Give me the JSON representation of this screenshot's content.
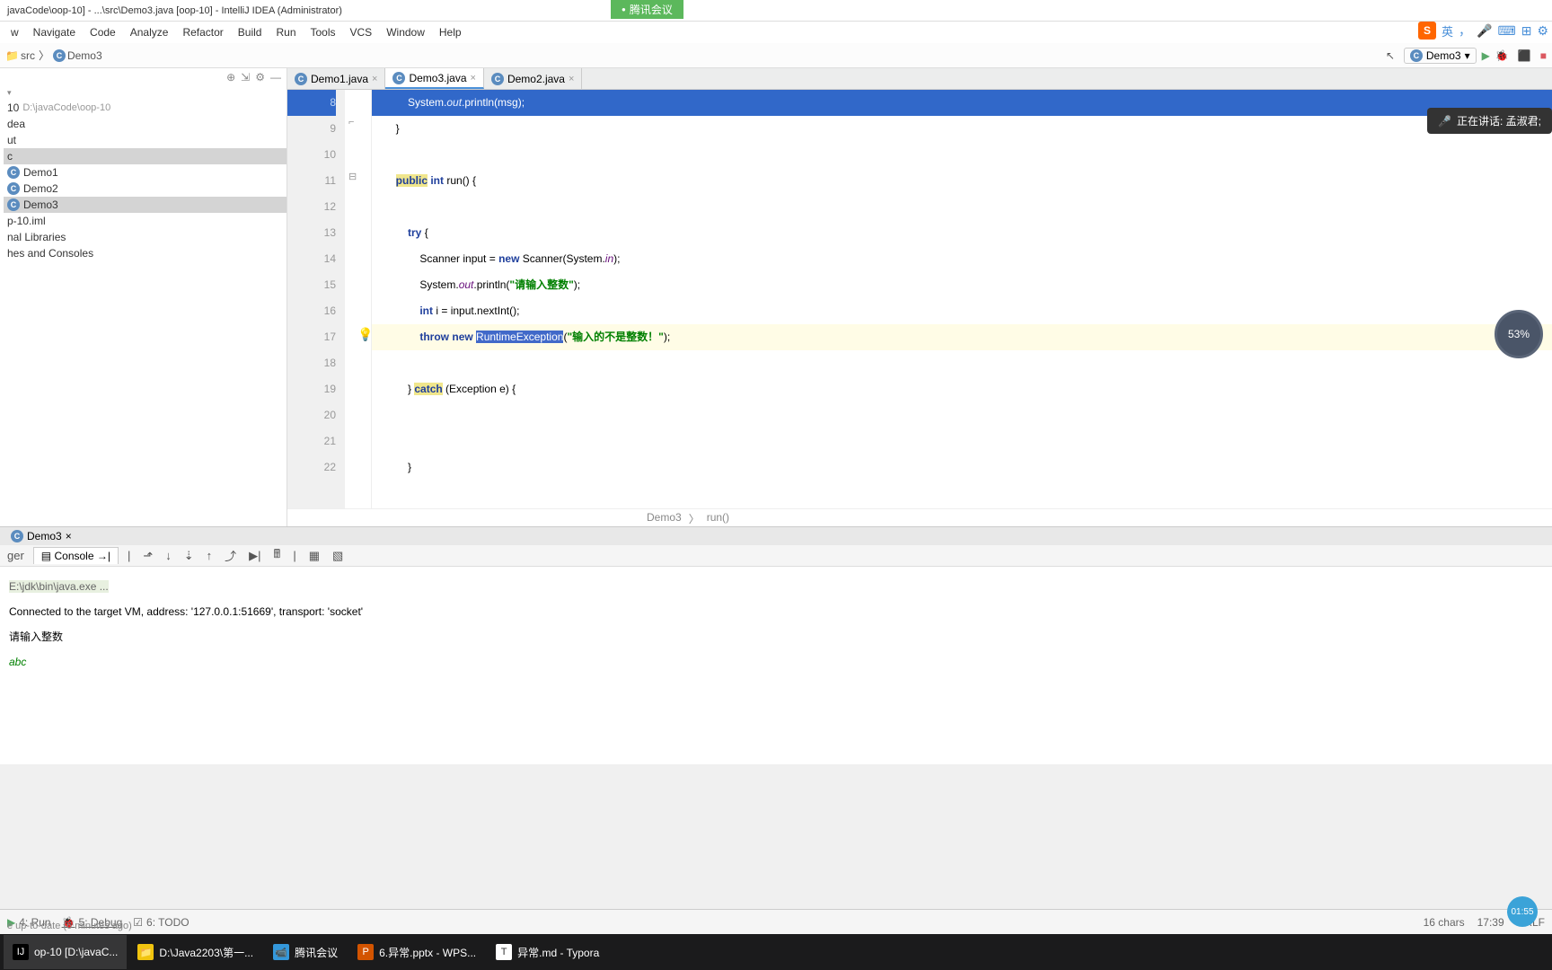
{
  "window": {
    "title": "javaCode\\oop-10] - ...\\src\\Demo3.java [oop-10] - IntelliJ IDEA (Administrator)"
  },
  "meeting": {
    "badge": "腾讯会议",
    "speaking": "正在讲话: 孟淑君;"
  },
  "menu": {
    "view": "w",
    "navigate": "Navigate",
    "code": "Code",
    "analyze": "Analyze",
    "refactor": "Refactor",
    "build": "Build",
    "run": "Run",
    "tools": "Tools",
    "vcs": "VCS",
    "window": "Window",
    "help": "Help"
  },
  "lang_indicator": {
    "text": "英",
    "comma": "，"
  },
  "breadcrumb": {
    "src": "src",
    "demo3": "Demo3"
  },
  "run_config": {
    "name": "Demo3"
  },
  "project": {
    "root": "10",
    "root_path": "D:\\javaCode\\oop-10",
    "idea": "dea",
    "ut": "ut",
    "c": "c",
    "demo1": "Demo1",
    "demo2": "Demo2",
    "demo3": "Demo3",
    "iml": "p-10.iml",
    "libs": "nal Libraries",
    "consoles": "hes and Consoles"
  },
  "tabs": {
    "demo1": "Demo1.java",
    "demo3": "Demo3.java",
    "demo2": "Demo2.java"
  },
  "code": {
    "l8": {
      "sys": "System.",
      "out": "out",
      "println": ".println(msg);"
    },
    "l9": "        }",
    "l11": {
      "pub": "public",
      "int_": " int ",
      "run": "run() {"
    },
    "l13": {
      "try_": "try",
      "brace": " {"
    },
    "l14": {
      "scanner": "Scanner input = ",
      "new_": "new",
      "sc2": " Scanner(System.",
      "in_": "in",
      "end": ");"
    },
    "l15": {
      "sys": "System.",
      "out": "out",
      "println": ".println(",
      "str": "\"请输入整数\"",
      "end": ");"
    },
    "l16": {
      "int_": "int",
      "rest": " i = input.nextInt();"
    },
    "l17": {
      "throw_": "throw",
      "sp": " ",
      "new_": "new",
      "sp2": " ",
      "rte": "RuntimeException",
      "paren": "(",
      "str": "\"输入的不是整数！\"",
      "end": ");"
    },
    "l19": {
      "brace": "            } ",
      "catch_": "catch",
      "rest": " (Exception e) {"
    },
    "l22": "            }"
  },
  "breadcrumb_bottom": {
    "class_": "Demo3",
    "method": "run()"
  },
  "percent": "53%",
  "debug": {
    "tab_name": "Demo3",
    "console_tab": "Console",
    "line1": "E:\\jdk\\bin\\java.exe ...",
    "line2": "Connected to the target VM, address: '127.0.0.1:51669', transport: 'socket'",
    "line3": "请输入整数",
    "line4": "abc"
  },
  "bottom_tabs": {
    "run": "4: Run",
    "debug": "5: Debug",
    "todo": "6: TODO"
  },
  "status": {
    "message": "e up-to-date (6 minutes ago)",
    "chars": "16 chars",
    "time": "17:39",
    "lf": "CRLF"
  },
  "taskbar": {
    "intellij": "op-10 [D:\\javaC...",
    "explorer": "D:\\Java2203\\第一...",
    "meeting": "腾讯会议",
    "wps": "6.异常.pptx - WPS...",
    "typora": "异常.md - Typora"
  },
  "clock": "01:55"
}
